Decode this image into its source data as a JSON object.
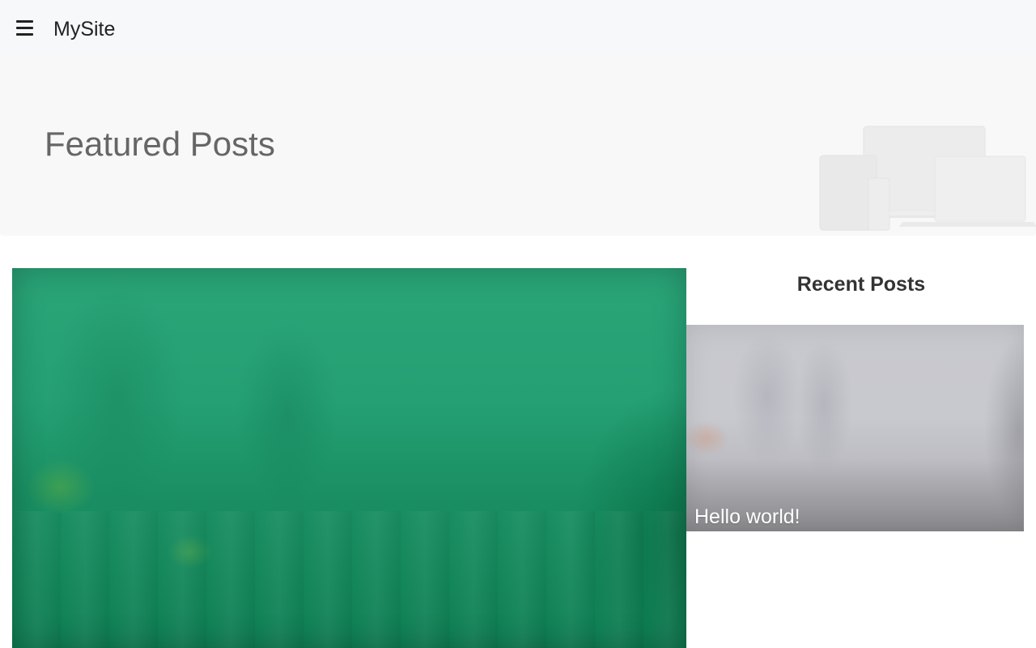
{
  "header": {
    "menu_icon": "hamburger-menu-icon",
    "site_name": "MySite"
  },
  "hero": {
    "title": "Featured Posts",
    "illustration_icon": "devices-illustration-icon"
  },
  "featured": {
    "image_description_color": "#24a074"
  },
  "sidebar": {
    "title": "Recent Posts",
    "posts": [
      {
        "title": "Hello world!"
      }
    ]
  },
  "colors": {
    "topbar_bg": "#f7f8fa",
    "hero_bg": "#f8f8f8",
    "hero_title": "#666666",
    "text_dark": "#222222"
  }
}
